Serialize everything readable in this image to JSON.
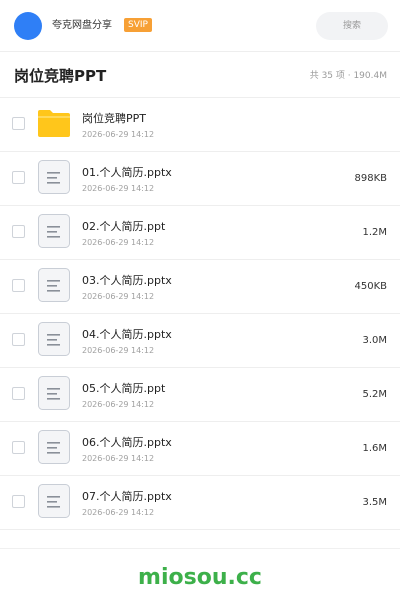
{
  "header": {
    "app_name": "夸克网盘分享",
    "badge": "SVIP",
    "search_placeholder": "搜索"
  },
  "folder": {
    "title": "岗位竞聘PPT",
    "summary": "共 35 项 · 190.4M"
  },
  "files": [
    {
      "name": "岗位竞聘PPT",
      "date": "2026-06-29 14:12",
      "size": "",
      "type": "folder-icon"
    },
    {
      "name": "01.个人简历.pptx",
      "date": "2026-06-29 14:12",
      "size": "898KB",
      "type": "document-icon"
    },
    {
      "name": "02.个人简历.ppt",
      "date": "2026-06-29 14:12",
      "size": "1.2M",
      "type": "document-icon"
    },
    {
      "name": "03.个人简历.pptx",
      "date": "2026-06-29 14:12",
      "size": "450KB",
      "type": "document-icon"
    },
    {
      "name": "04.个人简历.pptx",
      "date": "2026-06-29 14:12",
      "size": "3.0M",
      "type": "document-icon"
    },
    {
      "name": "05.个人简历.ppt",
      "date": "2026-06-29 14:12",
      "size": "5.2M",
      "type": "document-icon"
    },
    {
      "name": "06.个人简历.pptx",
      "date": "2026-06-29 14:12",
      "size": "1.6M",
      "type": "document-icon"
    },
    {
      "name": "07.个人简历.pptx",
      "date": "2026-06-29 14:12",
      "size": "3.5M",
      "type": "document-icon"
    }
  ],
  "watermark": "miosou.cc",
  "colors": {
    "avatar": "#2f7ff6",
    "svip_badge": "#f7a035",
    "folder": "#ffc61b",
    "watermark": "#3db04a"
  }
}
